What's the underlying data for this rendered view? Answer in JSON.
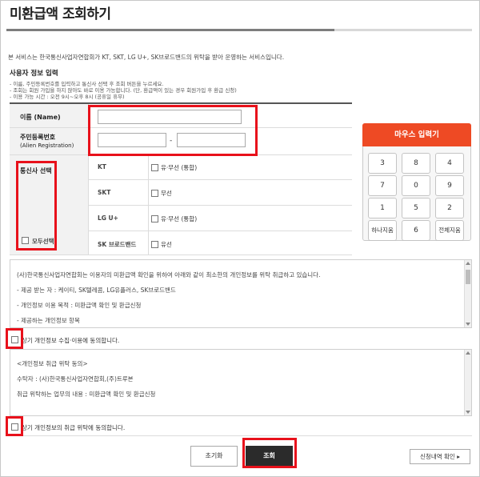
{
  "page": {
    "title": "미환급액 조회하기",
    "intro": "본 서비스는 한국통신사업자연합회가 KT, SKT, LG U+, SK브로드밴드의 위탁을 받아 운영하는 서비스입니다."
  },
  "form": {
    "section_title": "사용자 정보 입력",
    "notes": [
      "- 이름, 주민등록번호를 입력하고 통신사 선택 후 조회 버튼을 누르세요.",
      "- 조회는 회원 가입을 하지 않아도 바로 이용 가능합니다. (단, 환급액이 있는 경우 회원가입 후 환급 신청)",
      "- 이용 가능 시간 : 오전 9시~오후 8시 (공휴일 휴무)"
    ],
    "name_label": "이름 (Name)",
    "rrn_label": "주민등록번호",
    "rrn_sub_label": "(Alien Registration)",
    "rrn_separator": "-",
    "carrier_label": "통신사 선택",
    "select_all_label": "모두선택",
    "carriers": [
      {
        "name": "KT",
        "option": "유·무선 (통합)"
      },
      {
        "name": "SKT",
        "option": "무선"
      },
      {
        "name": "LG U+",
        "option": "유·무선 (통합)"
      },
      {
        "name": "SK 브로드밴드",
        "option": "유선"
      }
    ]
  },
  "keypad": {
    "title": "마우스 입력기",
    "keys": [
      "3",
      "8",
      "4",
      "7",
      "0",
      "9",
      "1",
      "5",
      "2",
      "하나지움",
      "6",
      "전체지움"
    ]
  },
  "privacy1": {
    "lines": [
      "(사)한국통신사업자연합회는 이용자의 미환급액 확인을 위하여 아래와 같이 최소한의 개인정보를 위탁 취급하고 있습니다.",
      "- 제공 받는 자 : 케이티, SK텔레콤, LG유플러스, SK브로드밴드",
      "- 개인정보 이용 목적 : 미환급액 확인 및 환급신청",
      "- 제공하는 개인정보 항목"
    ],
    "agree_label": "상기 개인정보 수집·이용에 동의합니다."
  },
  "privacy2": {
    "lines": [
      "<개인정보 취급 위탁 동의>",
      "수탁자 : (사)한국통신사업자연합회,(주)트루본",
      "취급 위탁하는 업무의 내용 : 미환급액 확인 및 환급신청"
    ],
    "agree_label": "상기 개인정보의 취급 위탁에 동의합니다."
  },
  "buttons": {
    "reset": "초기화",
    "search": "조회",
    "history": "신청내역 확인 ▸"
  },
  "colors": {
    "highlight": "#e8111b",
    "keypad_header": "#ee4a24",
    "search_button": "#2b2b2b"
  }
}
